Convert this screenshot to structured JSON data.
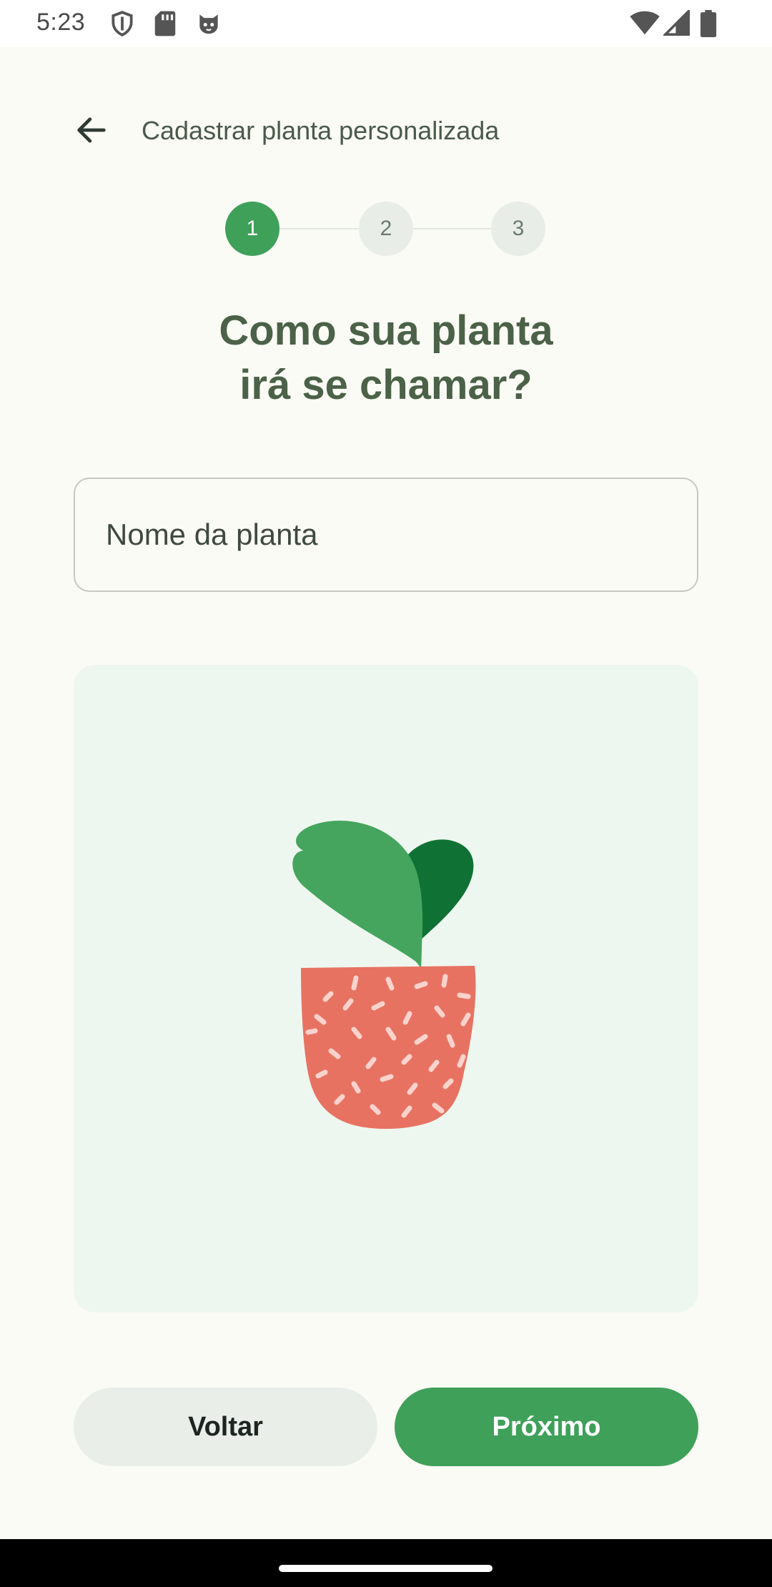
{
  "status_bar": {
    "time": "5:23",
    "icons_left": [
      "shield-icon",
      "sd-card-icon",
      "cat-face-icon"
    ],
    "icons_right": [
      "wifi-icon",
      "cell-signal-icon",
      "battery-icon"
    ]
  },
  "app_bar": {
    "back_icon": "arrow-back-icon",
    "title": "Cadastrar planta personalizada"
  },
  "stepper": {
    "steps": [
      {
        "label": "1",
        "state": "active"
      },
      {
        "label": "2",
        "state": "inactive"
      },
      {
        "label": "3",
        "state": "inactive"
      }
    ]
  },
  "heading": {
    "line1": "Como sua planta",
    "line2": "irá se chamar?"
  },
  "name_field": {
    "placeholder": "Nome da planta",
    "value": ""
  },
  "illustration": {
    "icon": "potted-plant-illustration"
  },
  "actions": {
    "back_label": "Voltar",
    "next_label": "Próximo"
  },
  "colors": {
    "accent": "#3fa05a",
    "heading": "#4b6148",
    "background": "#fafbf4",
    "card": "#eef7ef",
    "pot": "#e87060"
  }
}
